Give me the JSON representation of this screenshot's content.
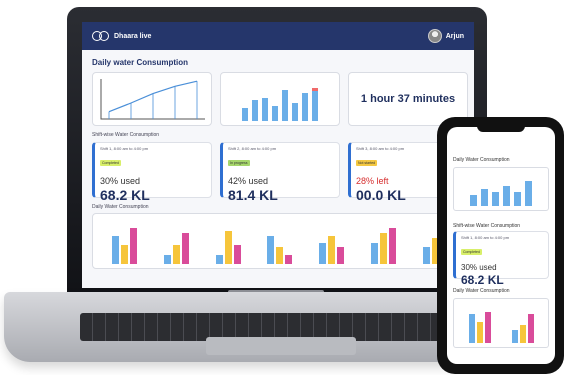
{
  "header": {
    "brand": "Dhaara live",
    "user_name": "Arjun"
  },
  "laptop": {
    "page_title": "Daily water Consumption",
    "line_chart": {
      "type": "line",
      "values": [
        10,
        22,
        35,
        45,
        52
      ]
    },
    "top_bar_chart": {
      "type": "bar",
      "values": [
        10,
        16,
        18,
        12,
        24,
        14,
        22,
        26
      ]
    },
    "duration": "1 hour 37 minutes",
    "shift_section_label": "Shift-wise Water Consumption",
    "shifts": [
      {
        "title": "Shift 1,   8:00 am to 4:00 pm",
        "status": "Completed",
        "status_color": "#d8ef6a",
        "used": "30% used",
        "amount": "68.2 KL",
        "used_color": "#333333"
      },
      {
        "title": "Shift 2,   8:00 am to 4:00 pm",
        "status": "In progress",
        "status_color": "#a6d66b",
        "used": "42% used",
        "amount": "81.4 KL",
        "used_color": "#333333"
      },
      {
        "title": "Shift 3,   8:00 am to 4:00 pm",
        "status": "Not started",
        "status_color": "#f4c842",
        "used": "28% left",
        "amount": "00.0 KL",
        "used_color": "#d62e2e"
      }
    ],
    "bottom_section_label": "Daily Water Consumption",
    "bottom_chart": {
      "type": "bar",
      "groups": [
        [
          24,
          16,
          30
        ],
        [
          8,
          16,
          26
        ],
        [
          8,
          28,
          16
        ],
        [
          24,
          14,
          8
        ],
        [
          18,
          24,
          14
        ],
        [
          18,
          26,
          30
        ],
        [
          14,
          22,
          10
        ]
      ]
    }
  },
  "phone": {
    "section1_label": "Daily Water Consumption",
    "bar_chart": {
      "type": "bar",
      "values": [
        8,
        12,
        10,
        14,
        10,
        18
      ]
    },
    "shift_section_label": "Shift-wise Water Consumption",
    "shift": {
      "title": "Shift 1,   8:00 am to 4:00 pm",
      "status": "Completed",
      "used": "30% used",
      "amount": "68.2 KL"
    },
    "section2_label": "Daily Water Consumption",
    "grouped_chart": {
      "type": "bar",
      "groups": [
        [
          22,
          16,
          24
        ],
        [
          10,
          14,
          22
        ]
      ]
    }
  },
  "colors": {
    "blue": "#6aaee8",
    "yellow": "#f6c53b",
    "pink": "#d94c9a",
    "navy": "#25366b",
    "line": "#4a8fd8",
    "accent_red": "#f06a6a"
  }
}
